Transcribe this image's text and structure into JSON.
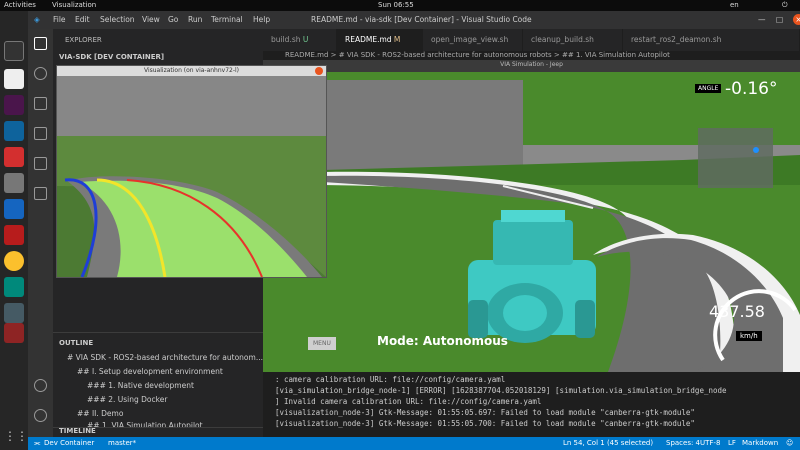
{
  "topbar": {
    "activities": "Activities",
    "app": "Visualization",
    "clock": "Sun 06:55",
    "lang": "en"
  },
  "titlebar": {
    "menus": [
      "File",
      "Edit",
      "Selection",
      "View",
      "Go",
      "Run",
      "Terminal",
      "Help"
    ],
    "title": "README.md - via-sdk [Dev Container] - Visual Studio Code"
  },
  "sidebar": {
    "explorer": "EXPLORER",
    "folder": "VIA-SDK [DEV CONTAINER]",
    "outline": "OUTLINE",
    "outline_items": [
      "# VIA SDK - ROS2-based architecture for autonom...",
      "## I. Setup development environment",
      "### 1. Native development",
      "### 2. Using Docker",
      "## II. Demo",
      "## 1. VIA Simulation Autopilot"
    ],
    "timeline": "TIMELINE"
  },
  "tabs": [
    {
      "label": "build.sh",
      "badge": "U"
    },
    {
      "label": "README.md",
      "badge": "M"
    },
    {
      "label": "open_image_view.sh",
      "badge": ""
    },
    {
      "label": "cleanup_build.sh",
      "badge": ""
    },
    {
      "label": "restart_ros2_deamon.sh",
      "badge": ""
    }
  ],
  "breadcrumb": "README.md > # VIA SDK - ROS2-based architecture for autonomous robots > ## 1. VIA Simulation Autopilot",
  "viz_window": {
    "title": "Visualization (on via-anhnv72-l)"
  },
  "sim_window": {
    "title": "VIA Simulation - Jeep"
  },
  "hud": {
    "angle_label": "ANGLE",
    "angle_value": "-0.16°",
    "speed": "437.58",
    "speed_unit": "km/h",
    "mode": "Mode: Autonomous",
    "menu_btn": "MENU"
  },
  "terminal": {
    "lines": [
      ": camera calibration URL: file://config/camera.yaml",
      "[via_simulation_bridge_node-1] [ERROR] [1628387704.052018129] [simulation.via_simulation_bridge_node",
      "] Invalid camera calibration URL: file://config/camera.yaml",
      "[visualization_node-3] Gtk-Message: 01:55:05.697: Failed to load module \"canberra-gtk-module\"",
      "[visualization_node-3] Gtk-Message: 01:55:05.700: Failed to load module \"canberra-gtk-module\""
    ]
  },
  "statusbar": {
    "container": "Dev Container",
    "branch": "master*",
    "position": "Ln 54, Col 1 (45 selected)",
    "spaces": "Spaces: 4",
    "encoding": "UTF-8",
    "eol": "LF",
    "language": "Markdown"
  },
  "colors": {
    "accent": "#007acc",
    "grass": "#4a8a2c",
    "road": "#6e6e6e",
    "jeep": "#3ec9c3"
  }
}
